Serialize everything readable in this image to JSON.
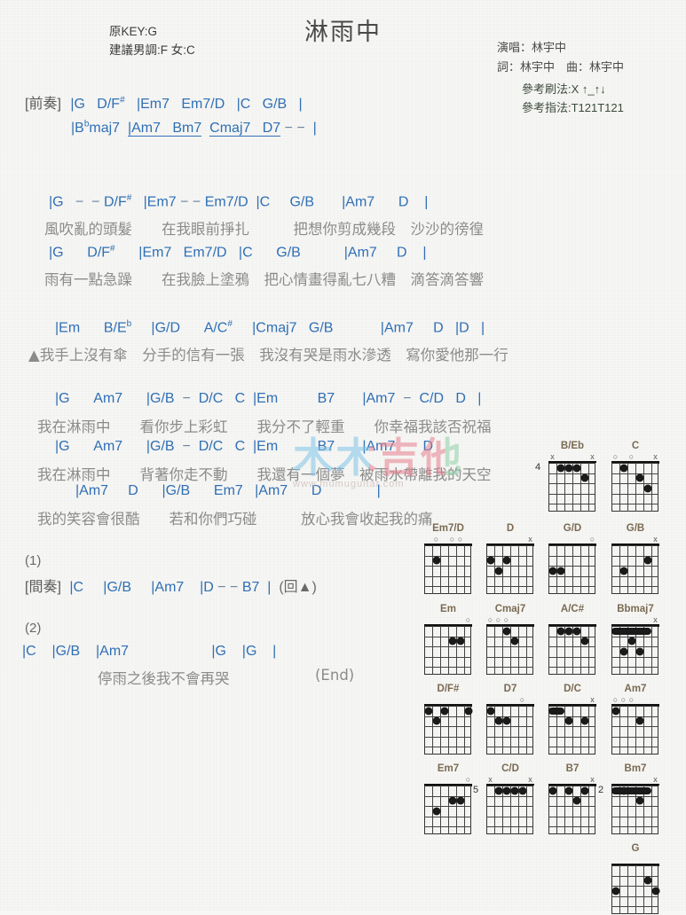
{
  "title": "淋雨中",
  "key_info": {
    "original_key": "原KEY:G",
    "suggested_key": "建議男調:F 女:C"
  },
  "credits": {
    "singer": "演唱：林宇中",
    "writers": "詞：林宇中　曲：林宇中"
  },
  "reference": {
    "strum": "參考刷法:X ↑_↑↓",
    "finger": "參考指法:T121T121"
  },
  "sections": {
    "intro_label": "[前奏]",
    "interlude_label": "[間奏]",
    "intro_line1": "|G   D/F#   |Em7   Em7/D   |C   G/B   |",
    "intro_line2": "|Bbmaj7   |Am7   Bm7   Cmaj7   D7 − −   |",
    "verse1_chords": "|G  − − D/F#   |Em7 − − Em7/D  |C     G/B       |Am7      D    |",
    "verse1_lyrics": "風吹亂的頭髮　　在我眼前掙扎　　　把想你剪成幾段　沙沙的徬徨",
    "verse2_chords": "|G      D/F#      |Em7   Em7/D   |C      G/B           |Am7     D    |",
    "verse2_lyrics": "雨有一點急躁　　在我臉上塗鴉　把心情畫得亂七八糟　滴答滴答響",
    "verse3_chords": "|Em      B/Eb      |G/D      A/C#      |Cmaj7   G/B            |Am7     D   |D   |",
    "verse3_lyrics": "▲我手上沒有傘　分手的信有一張　我沒有哭是雨水滲透　寫你愛他那一行",
    "chorus1_chords": "|G      Am7      |G/B  −  D/C   C  |Em           B7        |Am7  −  C/D   D   |",
    "chorus1_lyrics": "我在淋雨中　　看你步上彩虹　　我分不了輕重　　你幸福我該否祝福",
    "chorus2_chords": "|G      Am7      |G/B  −  D/C   C  |Em           B7        |Am7       D",
    "chorus2_lyrics": "我在淋雨中　　背著你走不動　　我還有一個夢　被雨水帶離我的天空",
    "chorus3_chords": "|Am7     D      |G/B      Em7   |Am7      D              |",
    "chorus3_lyrics": "我的笑容會很酷　　若和你們巧碰　　　放心我會收起我的痛",
    "ending1_num": "(1)",
    "interlude_line": "|C     |G/B     |Am7     |D − − B7  |  (回▲)",
    "ending2_num": "(2)",
    "ending_chords": "|C    |G/B    |Am7                     |G    |G    |",
    "ending_lyrics": "停雨之後我不會再哭",
    "end_mark": "(End)"
  },
  "watermark": {
    "main": "木木吉他",
    "sub": "www.mumuguitar.com"
  },
  "chord_diagrams": [
    {
      "name": "B/Eb",
      "fret_label": "4",
      "markers": [
        "x",
        "",
        "",
        "",
        "",
        "x"
      ],
      "dots": [
        [
          1,
          2
        ],
        [
          1,
          3
        ],
        [
          1,
          4
        ],
        [
          2,
          5
        ]
      ],
      "barre": null,
      "open_nut": false
    },
    {
      "name": "C",
      "fret_label": "",
      "markers": [
        "o",
        "",
        "o",
        "",
        "",
        "x"
      ],
      "dots": [
        [
          1,
          2
        ],
        [
          2,
          4
        ],
        [
          3,
          5
        ]
      ],
      "barre": null,
      "open_nut": true
    },
    {
      "name": "Em7/D",
      "fret_label": "",
      "markers": [
        "",
        "o",
        "",
        "o",
        "o",
        ""
      ],
      "dots": [
        [
          2,
          2
        ]
      ],
      "barre": null,
      "open_nut": true
    },
    {
      "name": "D",
      "fret_label": "",
      "markers": [
        "",
        "",
        "",
        "",
        "",
        "x"
      ],
      "dots": [
        [
          2,
          1
        ],
        [
          2,
          3
        ],
        [
          3,
          2
        ]
      ],
      "barre": null,
      "open_nut": true
    },
    {
      "name": "G/D",
      "fret_label": "",
      "markers": [
        "",
        "",
        "",
        "",
        "",
        "o"
      ],
      "dots": [
        [
          3,
          1
        ],
        [
          3,
          2
        ]
      ],
      "barre": null,
      "open_nut": true
    },
    {
      "name": "G/B",
      "fret_label": "",
      "markers": [
        "",
        "",
        "",
        "",
        "",
        "x"
      ],
      "dots": [
        [
          2,
          5
        ],
        [
          3,
          2
        ]
      ],
      "barre": null,
      "open_nut": true
    },
    {
      "name": "Em",
      "fret_label": "",
      "markers": [
        "",
        "",
        "",
        "",
        "",
        "o"
      ],
      "dots": [
        [
          2,
          5
        ],
        [
          2,
          4
        ]
      ],
      "barre": null,
      "open_nut": true
    },
    {
      "name": "Cmaj7",
      "fret_label": "",
      "markers": [
        "o",
        "o",
        "o",
        "",
        "",
        ""
      ],
      "dots": [
        [
          1,
          3
        ],
        [
          2,
          4
        ]
      ],
      "barre": null,
      "open_nut": true
    },
    {
      "name": "A/C#",
      "fret_label": "",
      "markers": [
        "",
        "",
        "",
        "",
        "",
        ""
      ],
      "dots": [
        [
          1,
          2
        ],
        [
          1,
          3
        ],
        [
          1,
          4
        ],
        [
          2,
          5
        ]
      ],
      "barre": null,
      "open_nut": true
    },
    {
      "name": "Bbmaj7",
      "fret_label": "",
      "markers": [
        "",
        "",
        "",
        "",
        "",
        "x"
      ],
      "dots": [
        [
          2,
          3
        ],
        [
          3,
          4
        ],
        [
          3,
          2
        ]
      ],
      "barre": [
        1,
        1,
        5
      ],
      "open_nut": true
    },
    {
      "name": "D/F#",
      "fret_label": "",
      "markers": [
        "",
        "",
        "",
        "",
        "",
        ""
      ],
      "dots": [
        [
          1,
          6
        ],
        [
          1,
          3
        ],
        [
          1,
          1
        ],
        [
          2,
          2
        ]
      ],
      "barre": null,
      "open_nut": true
    },
    {
      "name": "D7",
      "fret_label": "",
      "markers": [
        "",
        "",
        "",
        "",
        "o",
        ""
      ],
      "dots": [
        [
          1,
          1
        ],
        [
          2,
          2
        ],
        [
          2,
          3
        ]
      ],
      "barre": null,
      "open_nut": true
    },
    {
      "name": "D/C",
      "fret_label": "",
      "markers": [
        "",
        "",
        "",
        "",
        "",
        "x"
      ],
      "dots": [
        [
          2,
          5
        ],
        [
          2,
          3
        ]
      ],
      "barre": [
        1,
        1,
        2
      ],
      "open_nut": true
    },
    {
      "name": "Am7",
      "fret_label": "",
      "markers": [
        "o",
        "o",
        "o",
        "",
        "",
        ""
      ],
      "dots": [
        [
          1,
          1
        ],
        [
          2,
          4
        ]
      ],
      "barre": null,
      "open_nut": true
    },
    {
      "name": "Em7",
      "fret_label": "",
      "markers": [
        "",
        "",
        "",
        "",
        "",
        "o"
      ],
      "dots": [
        [
          2,
          5
        ],
        [
          2,
          4
        ],
        [
          3,
          2
        ]
      ],
      "barre": null,
      "open_nut": true
    },
    {
      "name": "C/D",
      "fret_label": "5",
      "markers": [
        "x",
        "",
        "",
        "",
        "",
        "x"
      ],
      "dots": [
        [
          1,
          2
        ],
        [
          1,
          3
        ],
        [
          1,
          4
        ],
        [
          1,
          5
        ]
      ],
      "barre": null,
      "open_nut": false
    },
    {
      "name": "B7",
      "fret_label": "",
      "markers": [
        "",
        "",
        "",
        "",
        "",
        "x"
      ],
      "dots": [
        [
          1,
          5
        ],
        [
          1,
          3
        ],
        [
          2,
          4
        ],
        [
          1,
          1
        ]
      ],
      "barre": null,
      "open_nut": true
    },
    {
      "name": "Bm7",
      "fret_label": "2",
      "markers": [
        "",
        "",
        "",
        "",
        "",
        "x"
      ],
      "dots": [
        [
          2,
          4
        ],
        [
          1,
          2
        ]
      ],
      "barre": [
        1,
        1,
        5
      ],
      "open_nut": false
    },
    {
      "name": "G",
      "fret_label": "",
      "markers": [
        "",
        "",
        "",
        "",
        "",
        ""
      ],
      "dots": [
        [
          2,
          5
        ],
        [
          3,
          6
        ],
        [
          3,
          1
        ]
      ],
      "barre": null,
      "open_nut": true
    }
  ]
}
